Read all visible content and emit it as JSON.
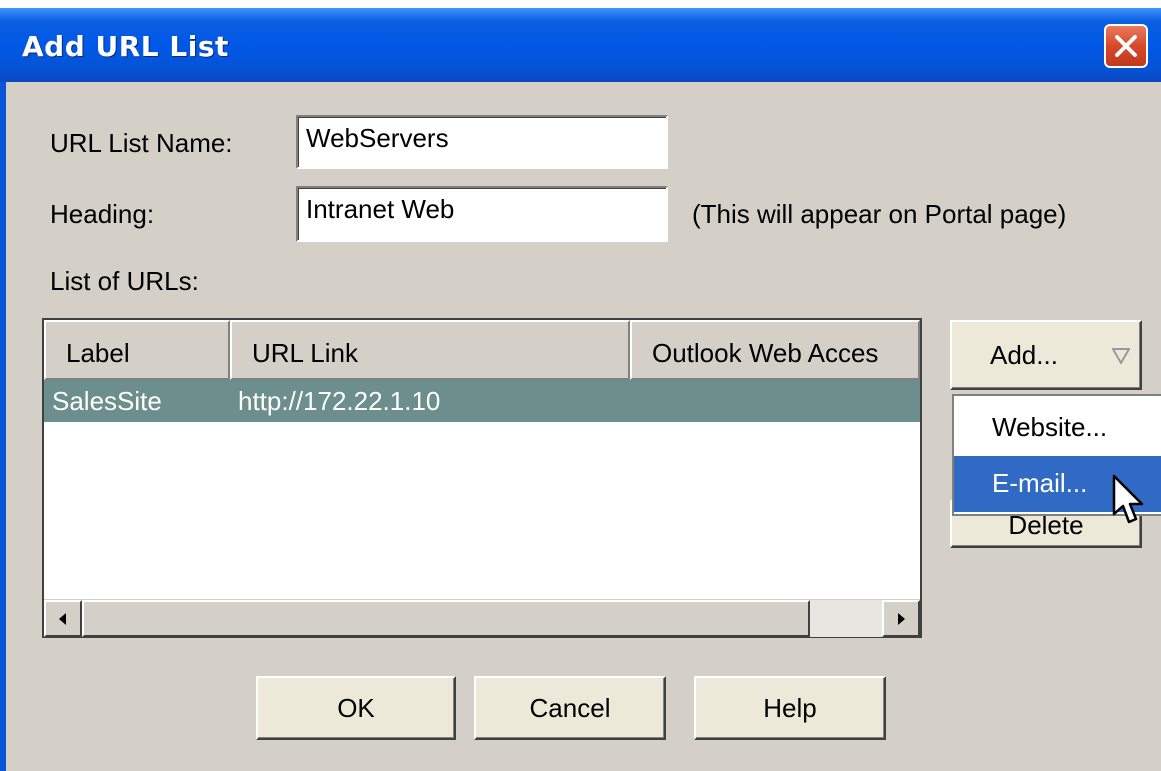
{
  "window": {
    "title": "Add URL List",
    "close_icon": "close-icon",
    "accent_color": "#0058e6"
  },
  "form": {
    "url_list_name_label": "URL List Name:",
    "url_list_name_value": "WebServers",
    "heading_label": "Heading:",
    "heading_value": "Intranet Web",
    "heading_hint": "(This will appear on Portal page)",
    "list_label": "List of URLs:"
  },
  "table": {
    "columns": [
      "Label",
      "URL Link",
      "Outlook Web Acces"
    ],
    "rows": [
      {
        "label": "SalesSite",
        "url": "http://172.22.1.10",
        "owa": ""
      }
    ],
    "selected_row_color": "#6c8e8c"
  },
  "side_buttons": {
    "add_label": "Add...",
    "add_icon": "triangle-down-icon",
    "delete_label": "Delete"
  },
  "add_menu": {
    "items": [
      {
        "label": "Website...",
        "active": false
      },
      {
        "label": "E-mail...",
        "active": true
      }
    ],
    "highlight_color": "#316ac5"
  },
  "footer": {
    "ok_label": "OK",
    "cancel_label": "Cancel",
    "help_label": "Help"
  }
}
